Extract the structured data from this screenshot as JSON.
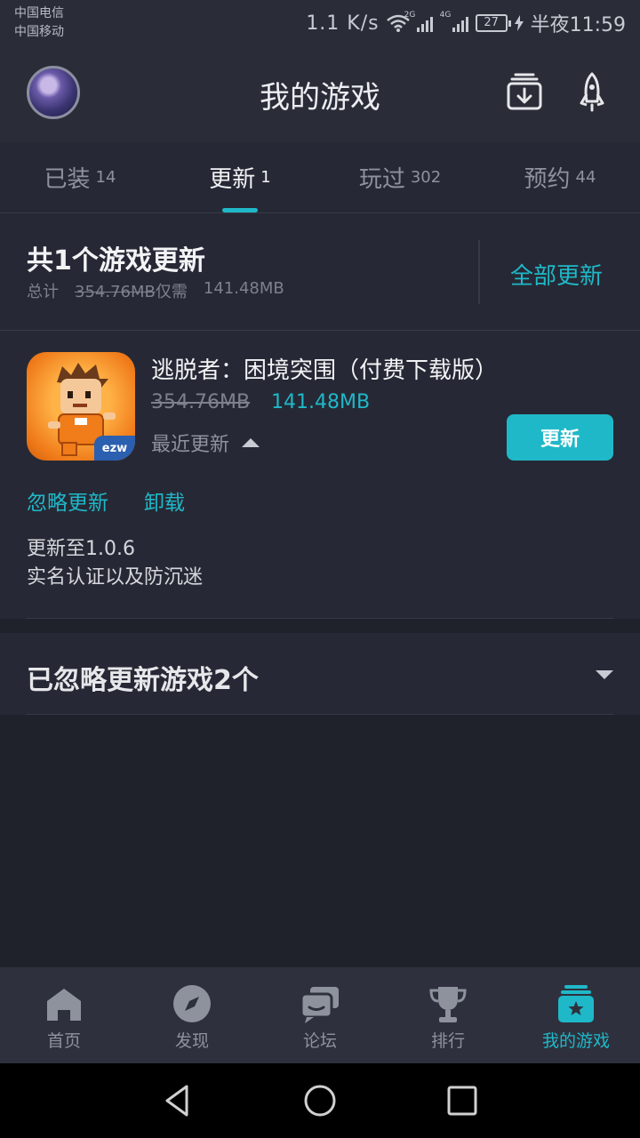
{
  "status_bar": {
    "carrier1": "中国电信",
    "carrier2": "中国移动",
    "speed": "1.1 K/s",
    "net1": "2G",
    "net2": "4G",
    "battery": "27",
    "time": "半夜11:59"
  },
  "header": {
    "title": "我的游戏"
  },
  "tabs": [
    {
      "label": "已装",
      "count": "14"
    },
    {
      "label": "更新",
      "count": "1"
    },
    {
      "label": "玩过",
      "count": "302"
    },
    {
      "label": "预约",
      "count": "44"
    }
  ],
  "summary": {
    "title": "共1个游戏更新",
    "total_label": "总计",
    "total_size": "354.76MB",
    "needed_label": "仅需",
    "needed_size": "141.48MB",
    "update_all": "全部更新"
  },
  "game": {
    "name": "逃脱者：困境突围（付费下载版）",
    "old_size": "354.76MB",
    "new_size": "141.48MB",
    "recent_label": "最近更新",
    "update_button": "更新",
    "ignore_link": "忽略更新",
    "uninstall_link": "卸载",
    "version_note": "更新至1.0.6",
    "change_note": "实名认证以及防沉迷",
    "badge": "ezw"
  },
  "ignored": {
    "title": "已忽略更新游戏2个"
  },
  "bottom_nav": [
    {
      "label": "首页",
      "icon": "home-icon"
    },
    {
      "label": "发现",
      "icon": "compass-icon"
    },
    {
      "label": "论坛",
      "icon": "forum-icon"
    },
    {
      "label": "排行",
      "icon": "trophy-icon"
    },
    {
      "label": "我的游戏",
      "icon": "my-games-icon"
    }
  ],
  "colors": {
    "accent": "#1fb8c8",
    "background": "#1f212b",
    "surface": "#262935"
  }
}
